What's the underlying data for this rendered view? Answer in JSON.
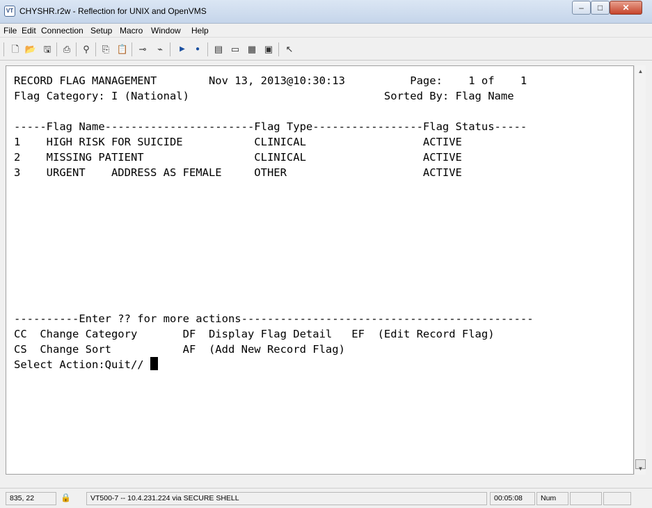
{
  "window": {
    "title": "CHYSHR.r2w - Reflection for UNIX and OpenVMS",
    "app_icon_text": "VT",
    "minimize_glyph": "–",
    "maximize_glyph": "□",
    "close_glyph": "✕"
  },
  "menu": [
    "File",
    "Edit",
    "Connection",
    "Setup",
    "Macro",
    "Window",
    "Help"
  ],
  "toolbar_icons": [
    "new-document-icon",
    "open-folder-icon",
    "save-icon",
    "print-icon",
    "find-icon",
    "copy-icon",
    "paste-icon",
    "connect-icon",
    "disconnect-icon",
    "play-macro-icon",
    "record-macro-icon",
    "settings-icon",
    "display-icon",
    "keyboard-icon",
    "mapping-icon",
    "context-help-icon"
  ],
  "terminal": {
    "lines": [
      "RECORD FLAG MANAGEMENT        Nov 13, 2013@10:30:13          Page:    1 of    1",
      "Flag Category: I (National)                              Sorted By: Flag Name",
      "",
      "-----Flag Name-----------------------Flag Type-----------------Flag Status-----",
      "1    HIGH RISK FOR SUICIDE           CLINICAL                  ACTIVE",
      "2    MISSING PATIENT                 CLINICAL                  ACTIVE",
      "3    URGENT    ADDRESS AS FEMALE     OTHER                     ACTIVE",
      "",
      "",
      "",
      "",
      "",
      "",
      "",
      "",
      "----------Enter ?? for more actions---------------------------------------------",
      "CC  Change Category       DF  Display Flag Detail   EF  (Edit Record Flag)",
      "CS  Change Sort           AF  (Add New Record Flag)",
      "Select Action:Quit// "
    ]
  },
  "status": {
    "cursor_position": "835, 22",
    "connection": "VT500-7 -- 10.4.231.224 via SECURE SHELL",
    "elapsed": "00:05:08",
    "num_lock": "Num"
  },
  "colors": {
    "terminal_bg": "#ffffff",
    "terminal_fg": "#000000",
    "close_button": "#c6452c"
  }
}
